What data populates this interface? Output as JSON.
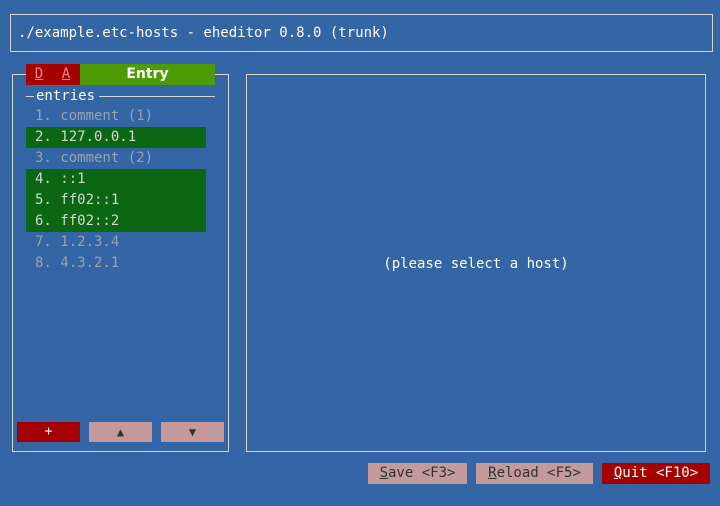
{
  "window": {
    "title": "./example.etc-hosts - eheditor 0.8.0 (trunk)"
  },
  "tabs": [
    {
      "label": "D"
    },
    {
      "label": "A"
    },
    {
      "label": "Entry"
    }
  ],
  "entries": {
    "label": "entries",
    "items": [
      {
        "text": "1. comment (1)",
        "selected": false
      },
      {
        "text": "2. 127.0.0.1",
        "selected": true
      },
      {
        "text": "3. comment (2)",
        "selected": false
      },
      {
        "text": "4. ::1",
        "selected": true
      },
      {
        "text": "5. ff02::1",
        "selected": true
      },
      {
        "text": "6. ff02::2",
        "selected": true
      },
      {
        "text": "7. 1.2.3.4",
        "selected": false
      },
      {
        "text": "8. 4.3.2.1",
        "selected": false
      }
    ]
  },
  "list_buttons": {
    "add": "+",
    "up": "▲",
    "down": "▼"
  },
  "detail": {
    "placeholder": "(please select a host)"
  },
  "footer": {
    "save": {
      "accel": "S",
      "rest": "ave <F3>"
    },
    "reload": {
      "accel": "R",
      "rest": "eload <F5>"
    },
    "quit": {
      "accel": "Q",
      "rest": "uit <F10>"
    }
  },
  "colors": {
    "background": "#3465a4",
    "selected_entry": "#0b6714",
    "active_tab": "#4e9a06",
    "danger": "#a40000",
    "inactive_button": "#c3999a"
  }
}
